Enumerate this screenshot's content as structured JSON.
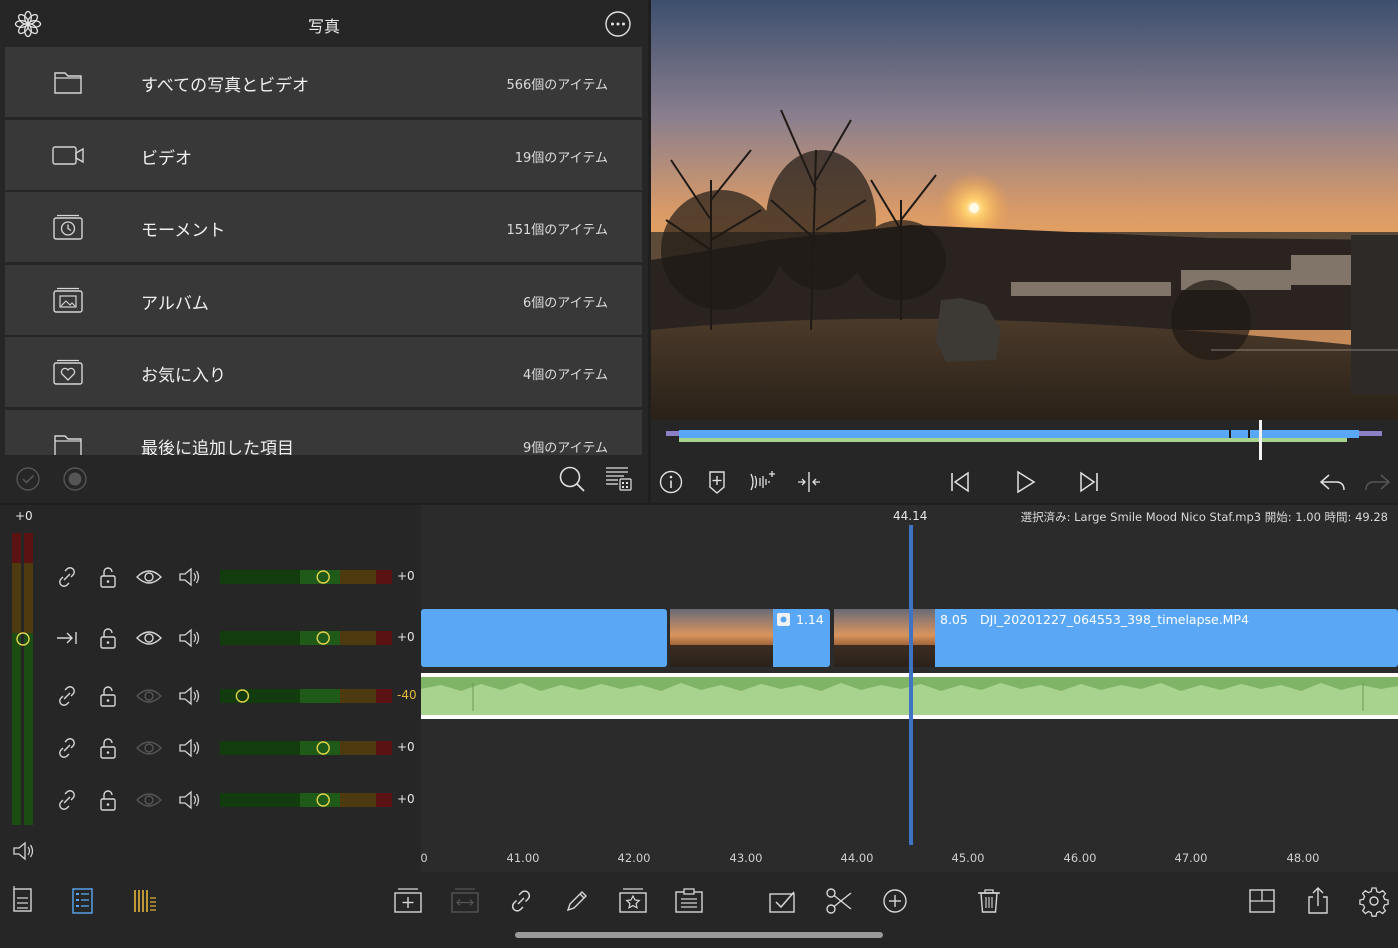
{
  "library": {
    "title": "写真",
    "items": [
      {
        "name": "すべての写真とビデオ",
        "count": "566個のアイテム",
        "icon": "folder-icon"
      },
      {
        "name": "ビデオ",
        "count": "19個のアイテム",
        "icon": "video-camera-icon"
      },
      {
        "name": "モーメント",
        "count": "151個のアイテム",
        "icon": "moments-clock-icon"
      },
      {
        "name": "アルバム",
        "count": "6個のアイテム",
        "icon": "album-icon"
      },
      {
        "name": "お気に入り",
        "count": "4個のアイテム",
        "icon": "favorites-heart-icon"
      },
      {
        "name": "最後に追加した項目",
        "count": "9個のアイテム",
        "icon": "folder-icon"
      }
    ]
  },
  "timeline": {
    "playhead_time": "44.14",
    "selected_info": "選択済み: Large Smile Mood  Nico Staf.mp3 開始: 1.00 時間: 49.28",
    "ruler": [
      "0",
      "41.00",
      "42.00",
      "43.00",
      "44.00",
      "45.00",
      "46.00",
      "47.00",
      "48.00"
    ],
    "clip_b_label": "1.14",
    "clip_c_duration": "8.05",
    "clip_c_name": "DJI_20201227_064553_398_timelapse.MP4"
  },
  "tracks": {
    "master_value": "+0",
    "rows": [
      {
        "value": "+0",
        "level": 0.6
      },
      {
        "value": "+0",
        "level": 0.6
      },
      {
        "value": "-40",
        "level": 0.13
      },
      {
        "value": "+0",
        "level": 0.6
      },
      {
        "value": "+0",
        "level": 0.6
      }
    ]
  },
  "colors": {
    "accent_blue": "#5aa8f5",
    "audio_green": "#a8d38e",
    "playhead": "#3f74c4",
    "warning_yellow": "#e3b53c"
  }
}
